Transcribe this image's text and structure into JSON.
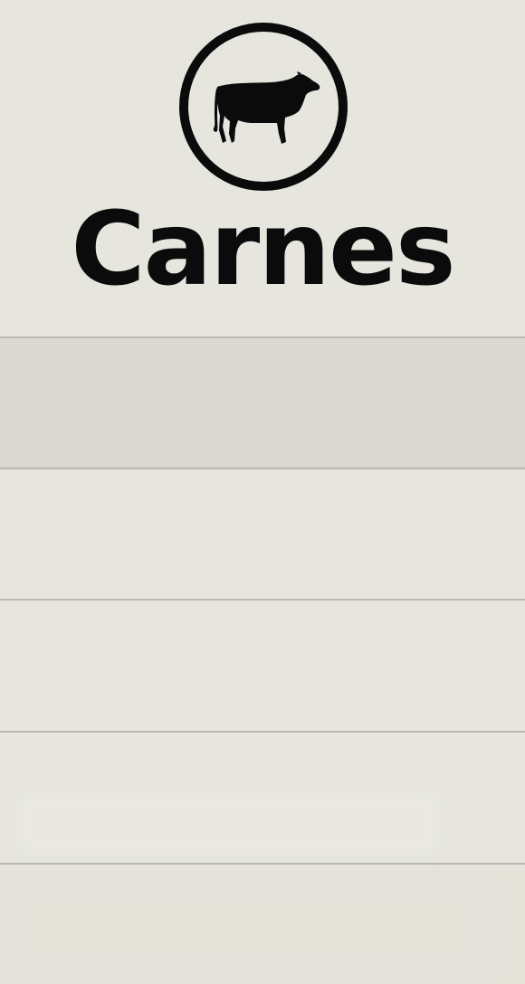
{
  "header": {
    "logo_icon": "cow-icon",
    "title": "Carnes"
  },
  "menu": {
    "items": [
      {
        "label": "",
        "state": "selected"
      },
      {
        "label": "",
        "state": "normal"
      },
      {
        "label": "",
        "state": "normal"
      },
      {
        "label": "",
        "state": "normal"
      },
      {
        "label": "",
        "state": "normal"
      }
    ]
  },
  "colors": {
    "background": "#e6e6de",
    "selected_row": "#d9d9d1",
    "divider": "#b9b9b2",
    "ink": "#0b0b0b"
  }
}
